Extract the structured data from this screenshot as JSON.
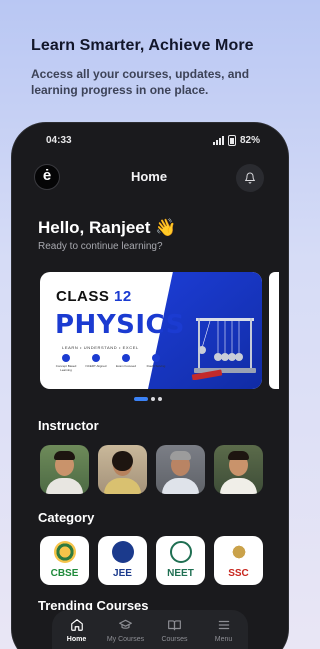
{
  "hero": {
    "title": "Learn Smarter, Achieve More",
    "subtitle": "Access all your courses, updates, and learning progress in one place."
  },
  "status": {
    "time": "04:33",
    "battery": "82%"
  },
  "app": {
    "logo": "ė",
    "title": "Home"
  },
  "greeting": {
    "hello": "Hello, Ranjeet 👋",
    "sub": "Ready to continue learning?"
  },
  "banner": {
    "class_word": "CLASS",
    "class_num": "12",
    "subject": "PHYSICS",
    "tagline": "LEARN  •  UNDERSTAND  •  EXCEL",
    "features": [
      "Concept Based Learning",
      "NCERT Aligned",
      "Exam Focused",
      "Doubt Solving"
    ],
    "slides_total": 3,
    "active_slide": 1
  },
  "sections": {
    "instructor": "Instructor",
    "category": "Category",
    "trending": "Trending Courses"
  },
  "categories": [
    {
      "label": "CBSE",
      "color": "#1f8a3b"
    },
    {
      "label": "JEE",
      "color": "#1b3a8c"
    },
    {
      "label": "NEET",
      "color": "#1f6f52"
    },
    {
      "label": "SSC",
      "color": "#c8271f"
    }
  ],
  "tabs": [
    {
      "label": "Home",
      "icon": "home-icon",
      "active": true
    },
    {
      "label": "My Courses",
      "icon": "graduation-cap-icon",
      "active": false
    },
    {
      "label": "Courses",
      "icon": "book-icon",
      "active": false
    },
    {
      "label": "Menu",
      "icon": "menu-icon",
      "active": false
    }
  ]
}
